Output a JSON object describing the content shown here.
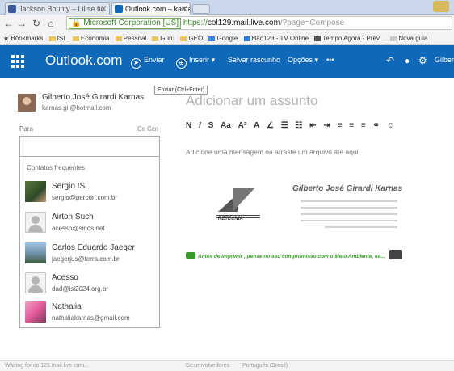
{
  "browser": {
    "tabs": [
      {
        "label": "Jackson Bounty – Lil se tic"
      },
      {
        "label": "Outlook.com – kamas.girl"
      }
    ],
    "url": {
      "secure_label": "Microsoft Corporation [US]",
      "scheme": "https://",
      "host": "col129.mail.live.com",
      "path": "/?page=Compose"
    },
    "bookmarks": [
      "Bookmarks",
      "ISL",
      "Economia",
      "Pessoal",
      "Guru",
      "GEO",
      "Google",
      "Hao123 - TV Online",
      "Tempo Agora - Prev...",
      "Nova guia"
    ]
  },
  "header": {
    "brand": "Outlook.com",
    "send_label": "Enviar",
    "insert_label": "Inserir ▾",
    "save_draft_label": "Salvar rascunho",
    "options_label": "Opções ▾",
    "more_label": "•••",
    "user_label": "Gilbert",
    "accent": "#0f68b8"
  },
  "tooltip": "Enviar (Ctrl+Enter)",
  "sender": {
    "name": "Gilberto José Girardi Karnas",
    "email": "karnas.gil@hotmail.com"
  },
  "recipients": {
    "to_label": "Para",
    "cc_label": "Cc Cco",
    "to_value": ""
  },
  "contacts": {
    "heading": "Contatos frequentes",
    "items": [
      {
        "name": "Sergio ISL",
        "email": "sergio@percon.com.br"
      },
      {
        "name": "Airton Such",
        "email": "acesso@sinos.net"
      },
      {
        "name": "Carlos Eduardo Jaeger",
        "email": "jaegerjus@terra.com.br"
      },
      {
        "name": "Acesso",
        "email": "dad@isl2024.org.br"
      },
      {
        "name": "Nathalia",
        "email": "nathaliakarnas@gmail.com"
      }
    ]
  },
  "compose": {
    "subject_placeholder": "Adicionar um assunto",
    "body_placeholder": "Adicione uma mensagem ou arraste um arquivo até aqui",
    "toolbar": [
      "N",
      "I",
      "S",
      "Aa",
      "A²",
      "A",
      "∠",
      "☰",
      "☷",
      "⇤",
      "⇥",
      "≡",
      "≡",
      "≡",
      "⚭",
      "☺"
    ]
  },
  "signature": {
    "logo_text": "RETECNIA",
    "name": "Gilberto José Girardi Karnas",
    "eco_text": "Antes de imprimir , pense no seu compromisso com o Meio Ambiente, ea..."
  },
  "statusbar": {
    "left": "Waiting for col129.mail.live.com...",
    "links": [
      "Desenvolvedores",
      "Português (Brasil)"
    ]
  }
}
